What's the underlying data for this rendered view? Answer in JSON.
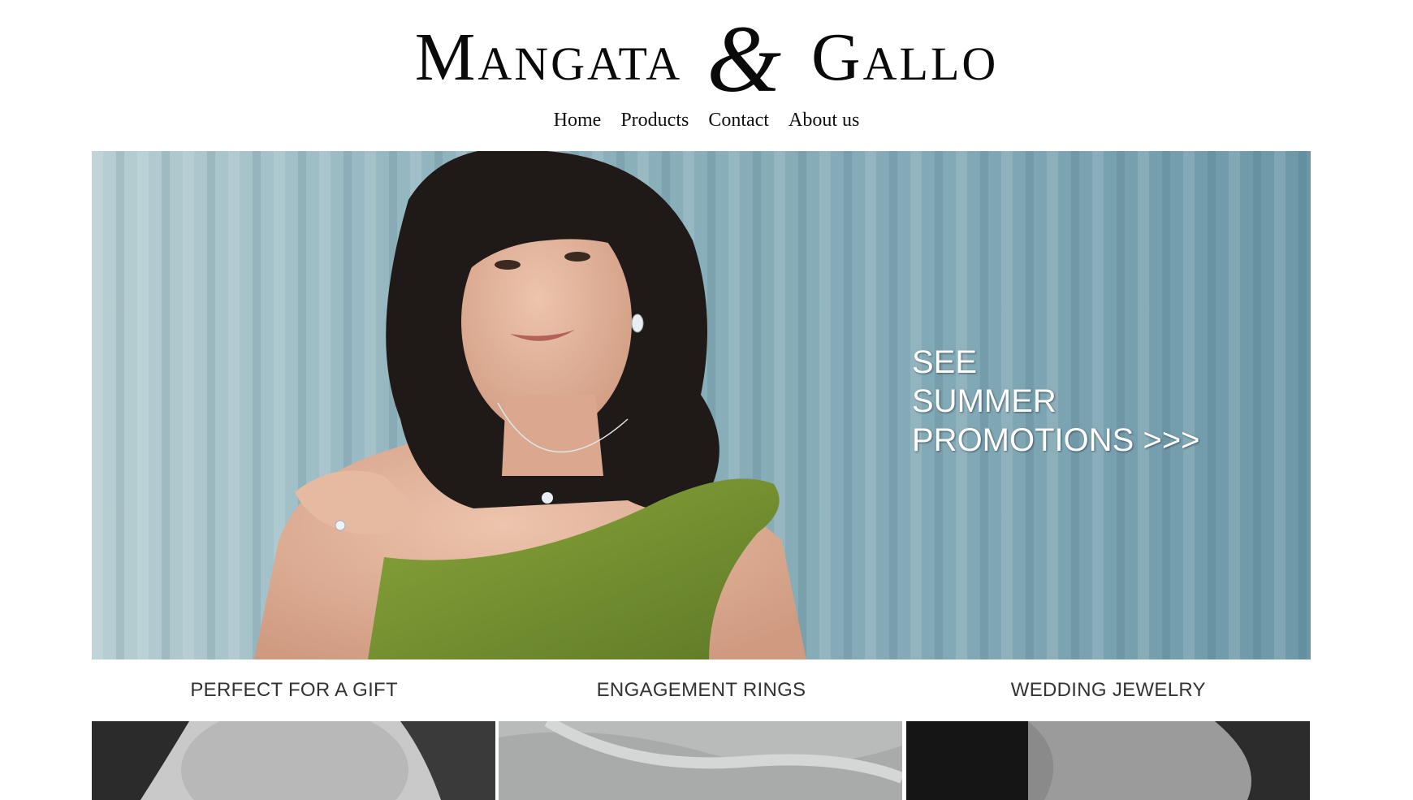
{
  "brand": {
    "word1_cap": "M",
    "word1_rest": "ANGATA",
    "ampersand": "&",
    "word2_cap": "G",
    "word2_rest": "ALLO"
  },
  "nav": {
    "items": [
      {
        "label": "Home"
      },
      {
        "label": "Products"
      },
      {
        "label": "Contact"
      },
      {
        "label": "About us"
      }
    ]
  },
  "hero": {
    "promo_line1": "SEE",
    "promo_line2": "SUMMER",
    "promo_line3": "PROMOTIONS >>>"
  },
  "categories": [
    {
      "title": "PERFECT FOR A GIFT"
    },
    {
      "title": "ENGAGEMENT RINGS"
    },
    {
      "title": "WEDDING JEWELRY"
    }
  ],
  "colors": {
    "curtain": "#8fb3bd",
    "dress": "#7a9432",
    "hair": "#1f1a17",
    "skin": "#e2b49c"
  }
}
